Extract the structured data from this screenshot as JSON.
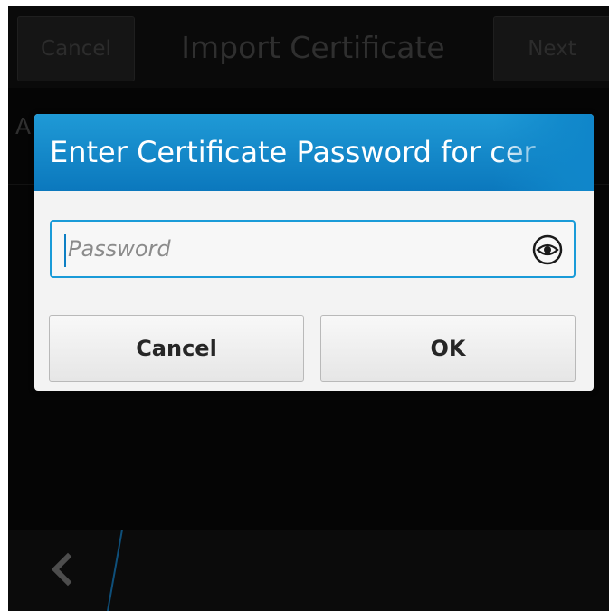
{
  "titlebar": {
    "cancel_label": "Cancel",
    "title": "Import Certificate",
    "next_label": "Next"
  },
  "background": {
    "partial_text": "A"
  },
  "dialog": {
    "title": "Enter Certificate Password for cer",
    "password_placeholder": "Password",
    "password_value": "",
    "cancel_label": "Cancel",
    "ok_label": "OK"
  },
  "actionbar": {
    "back_icon": "chevron-left-icon"
  },
  "colors": {
    "dialog_header": "#1087c9",
    "field_focus": "#1a9bd8",
    "screen_bg": "#050505"
  }
}
